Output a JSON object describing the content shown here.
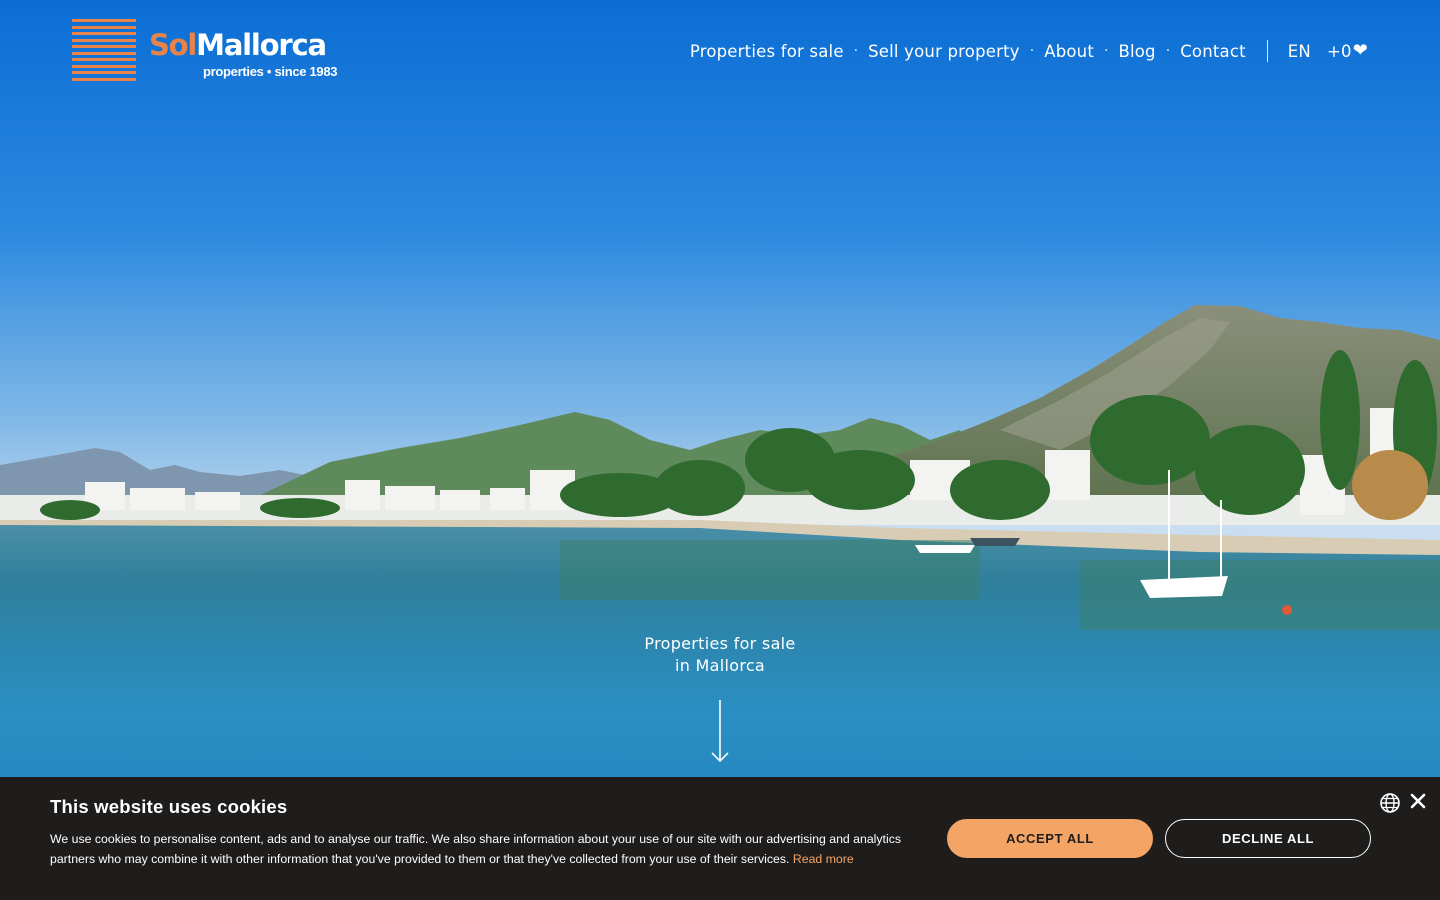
{
  "header": {
    "logo": {
      "name_part1": "Sol",
      "name_part2": "Mallorca",
      "tagline": "properties • since 1983"
    },
    "nav": {
      "items": [
        {
          "label": "Properties for sale"
        },
        {
          "label": "Sell your property"
        },
        {
          "label": "About"
        },
        {
          "label": "Blog"
        },
        {
          "label": "Contact"
        }
      ],
      "separator": "·",
      "language": "EN",
      "favorites_count": "+0",
      "favorites_icon": "heart-icon"
    }
  },
  "hero": {
    "caption_line1": "Properties for sale",
    "caption_line2": "in Mallorca",
    "scroll_icon": "arrow-down-icon"
  },
  "cookie_banner": {
    "title": "This website uses cookies",
    "text": "We use cookies to personalise content, ads and to analyse our traffic. We also share information about your use of our site with our advertising and analytics partners who may combine it with other information that you've provided to them or that they've collected from your use of their services.",
    "read_more": "Read more",
    "accept_label": "ACCEPT ALL",
    "decline_label": "DECLINE ALL",
    "language_icon": "globe-icon",
    "close_icon": "close-icon"
  },
  "colors": {
    "brand_orange": "#e8834a",
    "accept_button": "#f4a566",
    "banner_background": "#1f1d1c",
    "sky_top": "#0a6fd6",
    "sea": "#2a8fc4"
  }
}
